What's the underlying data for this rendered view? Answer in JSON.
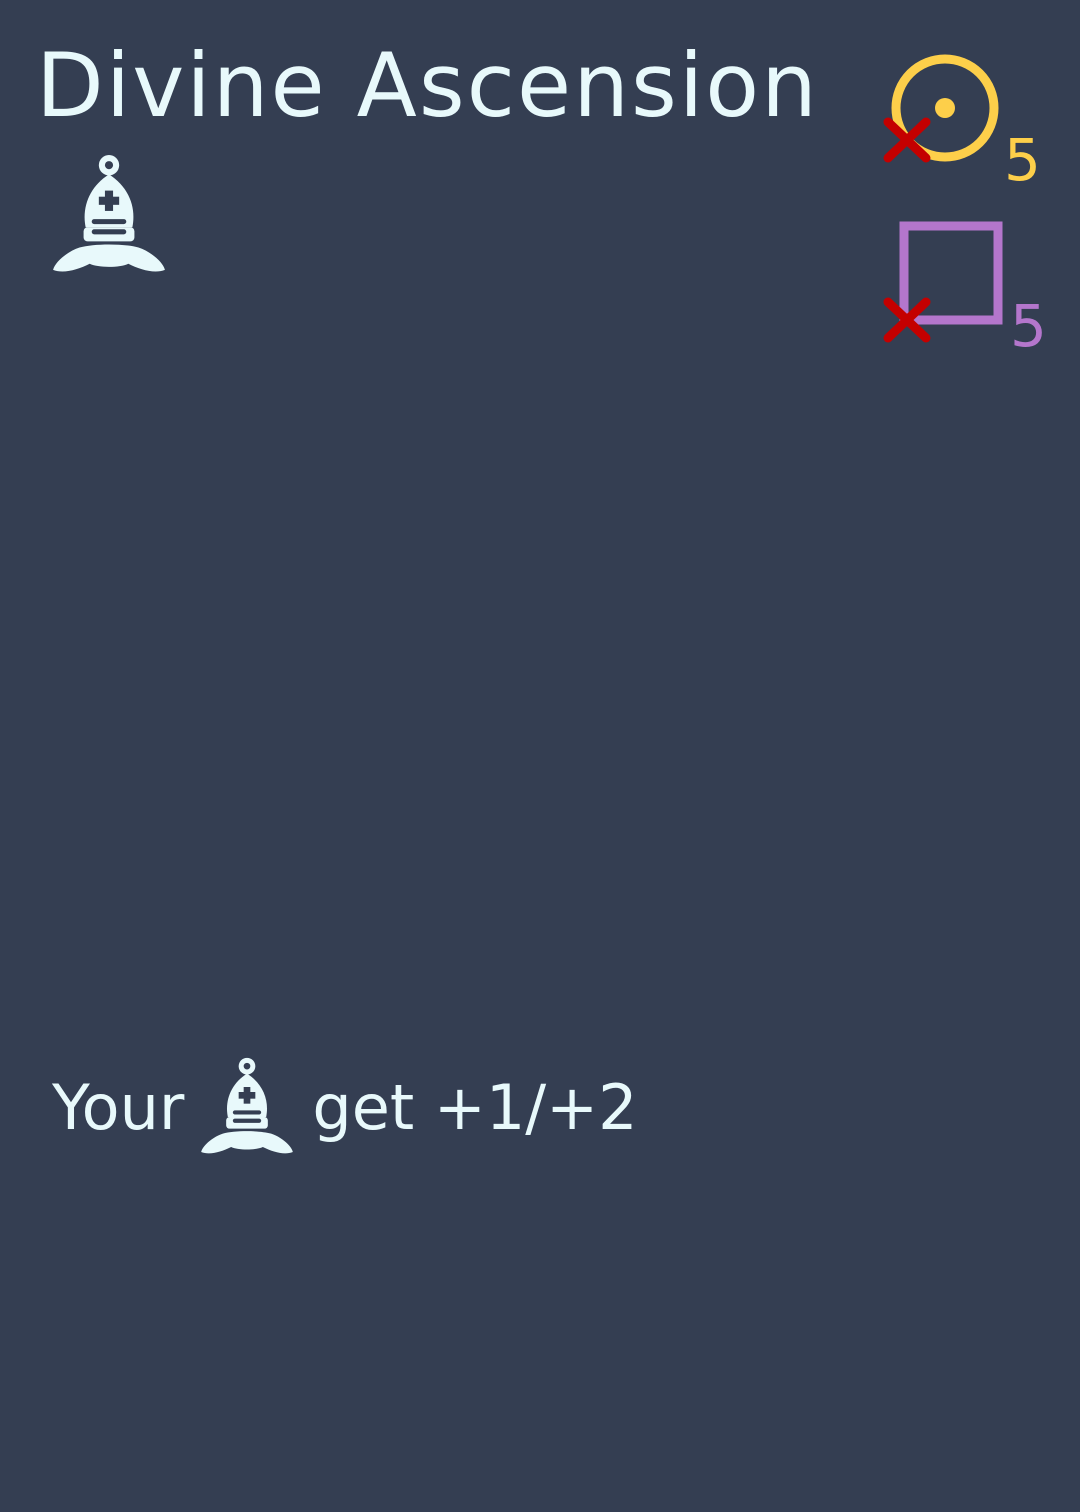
{
  "card": {
    "title": "Divine Ascension",
    "type_icon": "bishop-icon",
    "background_color": "#343e52",
    "text_color": "#e8f9fb"
  },
  "costs": [
    {
      "icon": "sun-icon",
      "value": "5",
      "color": "#fdcf4a",
      "crossed": true,
      "cross_color": "#c40000"
    },
    {
      "icon": "square-icon",
      "value": "5",
      "color": "#b476cc",
      "crossed": true,
      "cross_color": "#c40000"
    }
  ],
  "ability": {
    "prefix": "Your",
    "icon": "bishop-icon",
    "suffix": "get +1/+2"
  }
}
